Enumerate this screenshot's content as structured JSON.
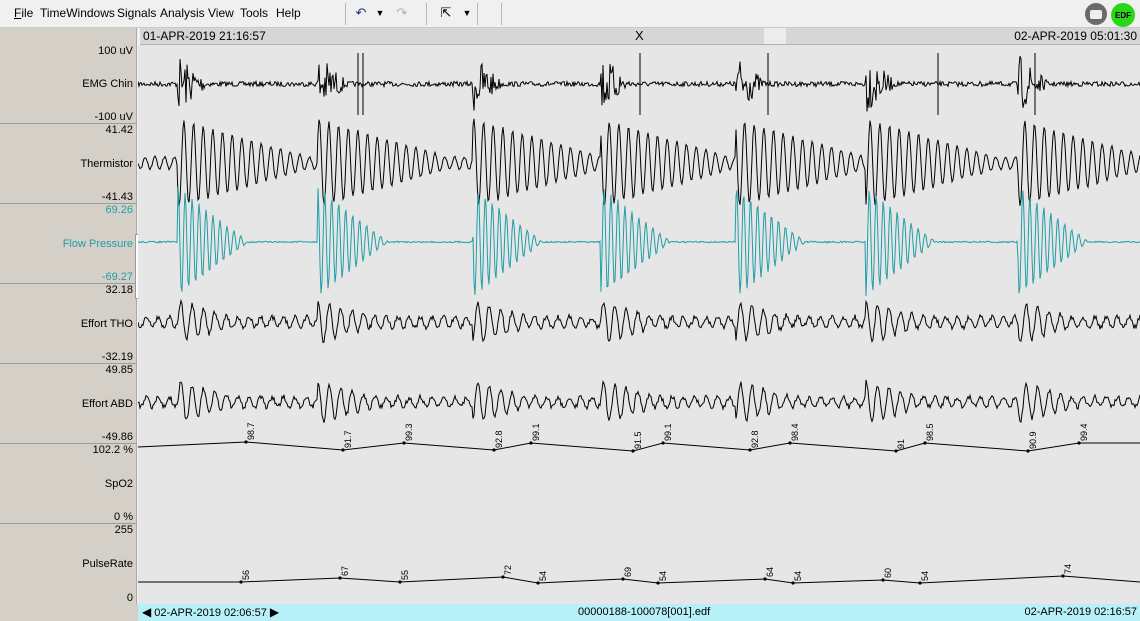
{
  "menu": [
    "File",
    "TimeWindows",
    "Signals",
    "Analysis",
    "View",
    "Tools",
    "Help"
  ],
  "menu_accel": [
    "F",
    "T",
    "S",
    "A",
    "V",
    "o",
    "H"
  ],
  "toolbar": {
    "undo_icon": "undo-icon",
    "redo_icon": "redo-icon",
    "pointer_icon": "pointer-icon",
    "edf_label": "EDF"
  },
  "timebar": {
    "start": "01-APR-2019 21:16:57",
    "end": "02-APR-2019 05:01:30",
    "close": "X"
  },
  "statusbar": {
    "left": "02-APR-2019 02:06:57",
    "file": "00000188-100078[001].edf",
    "right": "02-APR-2019 02:16:57"
  },
  "channels": [
    {
      "name": "EMG Chin",
      "top": "100 uV",
      "bottom": "-100 uV",
      "color": "#000000"
    },
    {
      "name": "Thermistor",
      "top": "41.42",
      "bottom": "-41.43",
      "color": "#000000"
    },
    {
      "name": "Flow Pressure",
      "top": "69.26",
      "bottom": "-69.27",
      "color": "#1f9ea8"
    },
    {
      "name": "Effort THO",
      "top": "32.18",
      "bottom": "-32.19",
      "color": "#000000"
    },
    {
      "name": "Effort ABD",
      "top": "49.85",
      "bottom": "-49.86",
      "color": "#000000"
    },
    {
      "name": "SpO2",
      "top": "102.2 %",
      "bottom": "0 %",
      "color": "#000000"
    },
    {
      "name": "PulseRate",
      "top": "255",
      "bottom": "0",
      "color": "#000000"
    }
  ],
  "spo2_annotations": [
    "98.7",
    "91.7",
    "99.3",
    "92.8",
    "99.1",
    "91.5",
    "99.1",
    "92.8",
    "98.4",
    "91",
    "98.5",
    "90.9",
    "99.4"
  ],
  "pulse_annotations": [
    "56",
    "67",
    "55",
    "72",
    "54",
    "69",
    "54",
    "64",
    "54",
    "60",
    "54",
    "74"
  ]
}
